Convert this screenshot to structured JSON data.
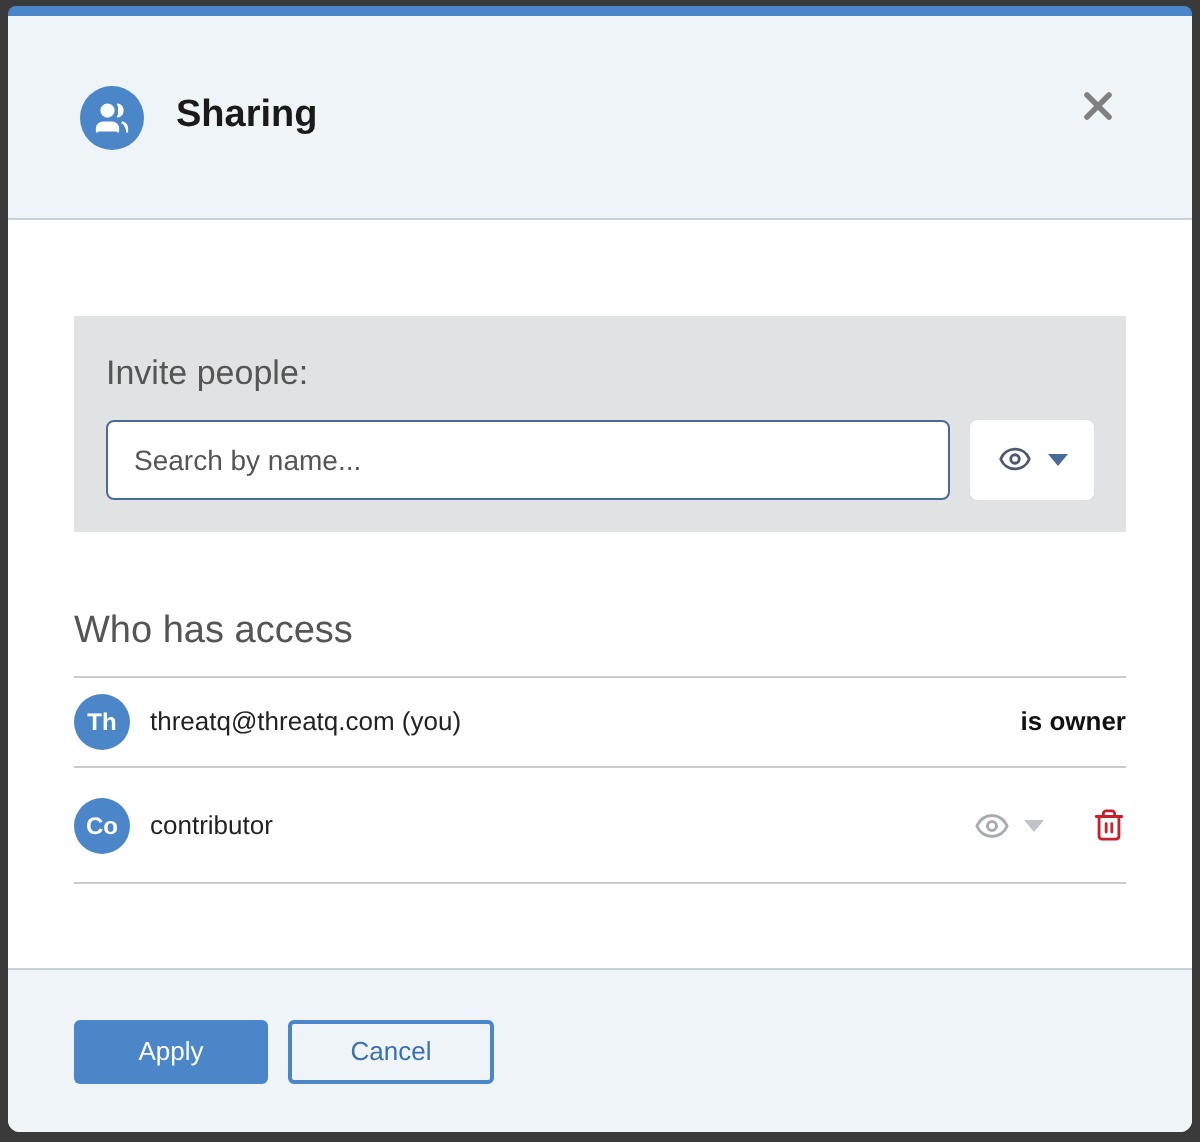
{
  "dialog": {
    "title": "Sharing"
  },
  "invite": {
    "label": "Invite people:",
    "search": {
      "placeholder": "Search by name..."
    }
  },
  "access": {
    "heading": "Who has access",
    "people": [
      {
        "initials": "Th",
        "name": "threatq@threatq.com (you)",
        "kind": "owner",
        "role": "is owner"
      },
      {
        "initials": "Co",
        "name": "contributor",
        "kind": "member"
      }
    ]
  },
  "buttons": [
    {
      "label": "Apply",
      "kind": "primary"
    },
    {
      "label": "Cancel",
      "kind": "secondary"
    }
  ]
}
